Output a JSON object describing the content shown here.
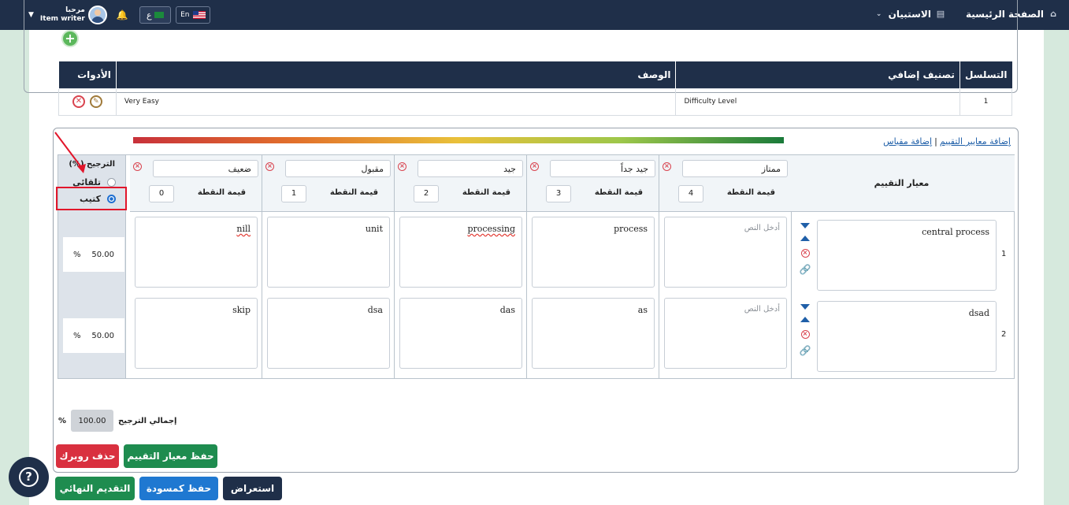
{
  "header": {
    "home_label": "الصفحة الرئيسية",
    "survey_label": "الاستبيان",
    "greeting": "مرحبا",
    "user_role": "Item writer",
    "lang_ar": "ع",
    "lang_en": "En"
  },
  "section1": {
    "add_label": "+",
    "columns": [
      "التسلسل",
      "تصنيف إضافي",
      "الوصف",
      "الأدوات"
    ],
    "rows": [
      {
        "seq": "1",
        "classification": "Difficulty Level",
        "description": "Very Easy"
      }
    ]
  },
  "section2": {
    "add_criteria_link": "إضافة معايير التقييم",
    "add_scale_link": "إضافة مقياس",
    "link_separator": "|",
    "criteria_header": "معيار التقييم",
    "weight_header": "(%) الترجيح",
    "radio_auto": "تلقائي",
    "radio_manual": "كتيب",
    "points_label": "قيمة النقطة",
    "levels": [
      {
        "name": "ممتاز",
        "points": "4"
      },
      {
        "name": "جيد جداً",
        "points": "3"
      },
      {
        "name": "جيد",
        "points": "2"
      },
      {
        "name": "مقبول",
        "points": "1"
      },
      {
        "name": "ضعيف",
        "points": "0"
      }
    ],
    "rows": [
      {
        "num": "1",
        "criterion": "central process",
        "cells": [
          "أدخل النص",
          "process",
          "processing",
          "unit",
          "nill"
        ],
        "weight": "50.00",
        "weight_unit": "%"
      },
      {
        "num": "2",
        "criterion": "dsad",
        "cells": [
          "أدخل النص",
          "as",
          "das",
          "dsa",
          "skip"
        ],
        "weight": "50.00",
        "weight_unit": "%"
      }
    ],
    "total_label": "إجمالي الترجيح",
    "total_value": "100.00",
    "total_unit": "%",
    "save_rubric_btn": "حفظ معيار التقييم",
    "delete_rubric_btn": "حذف روبرك"
  },
  "footer": {
    "preview_btn": "استعراض",
    "save_draft_btn": "حفظ كمسودة",
    "final_submit_btn": "التقديم النهائي"
  },
  "colors": {
    "navy": "#1f2f49",
    "green": "#1e8c4f",
    "blue": "#1f78d1",
    "red": "#d9303f",
    "highlight": "#e2162b"
  }
}
